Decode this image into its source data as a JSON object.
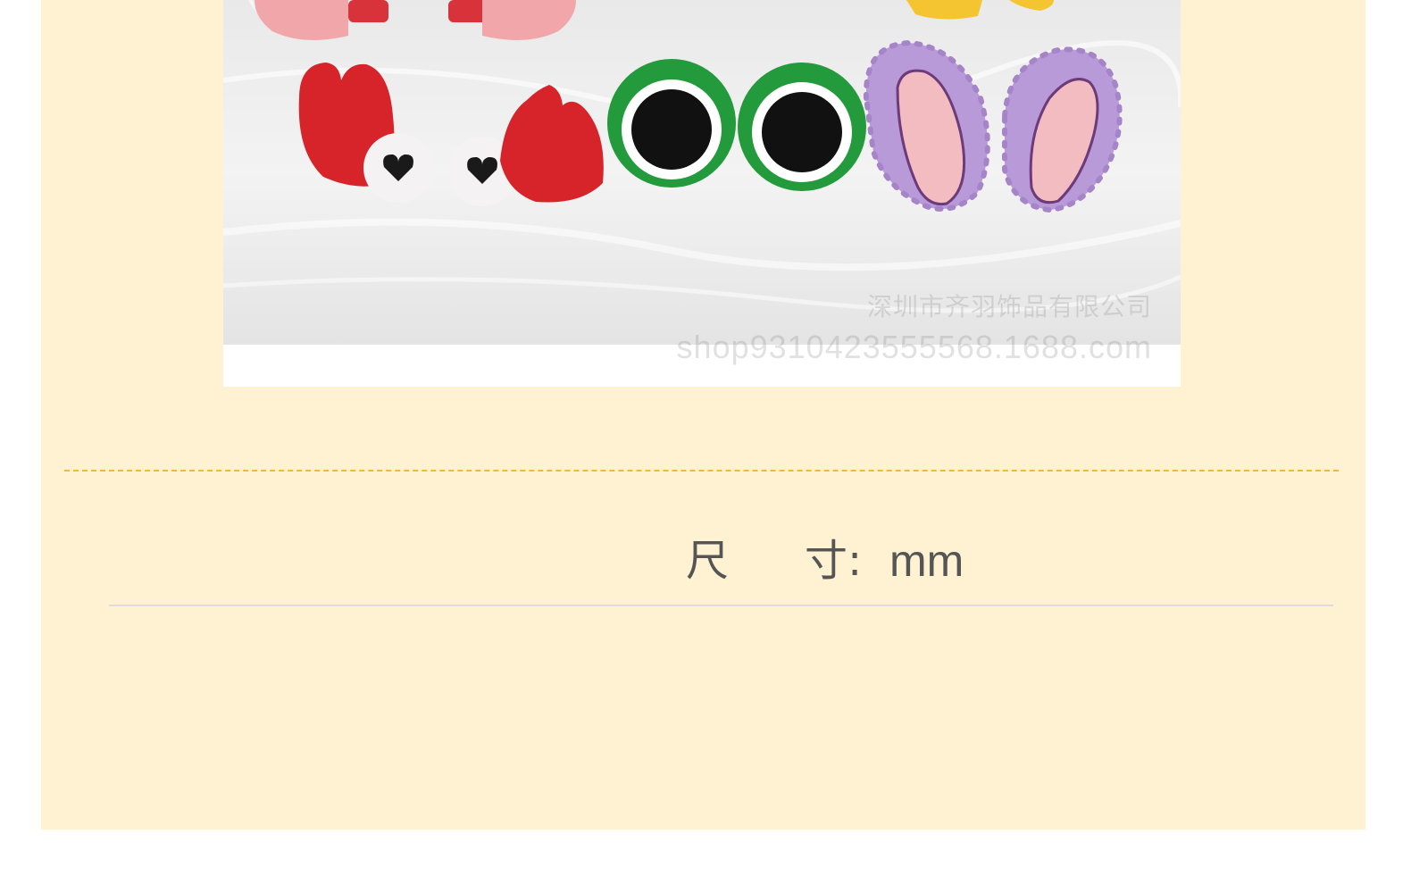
{
  "product_photo": {
    "watermark_line_1": "深圳市齐羽饰品有限公司",
    "watermark_line_2": "shop9310423555568.1688.com",
    "items": [
      "crab-earrings-icon",
      "frog-eye-earrings-icon",
      "bunny-ear-earrings-icon"
    ]
  },
  "specs": {
    "size_label_part1": "尺",
    "size_label_part2": "寸:",
    "size_unit": "mm"
  },
  "colors": {
    "panel_background": "#fef2d2",
    "dashed_divider": "#f2b838",
    "text": "#555555",
    "crab_red": "#d6242a",
    "frog_green": "#239a3b",
    "bunny_purple": "#b99ad8",
    "bunny_pink": "#f2bcc1"
  }
}
